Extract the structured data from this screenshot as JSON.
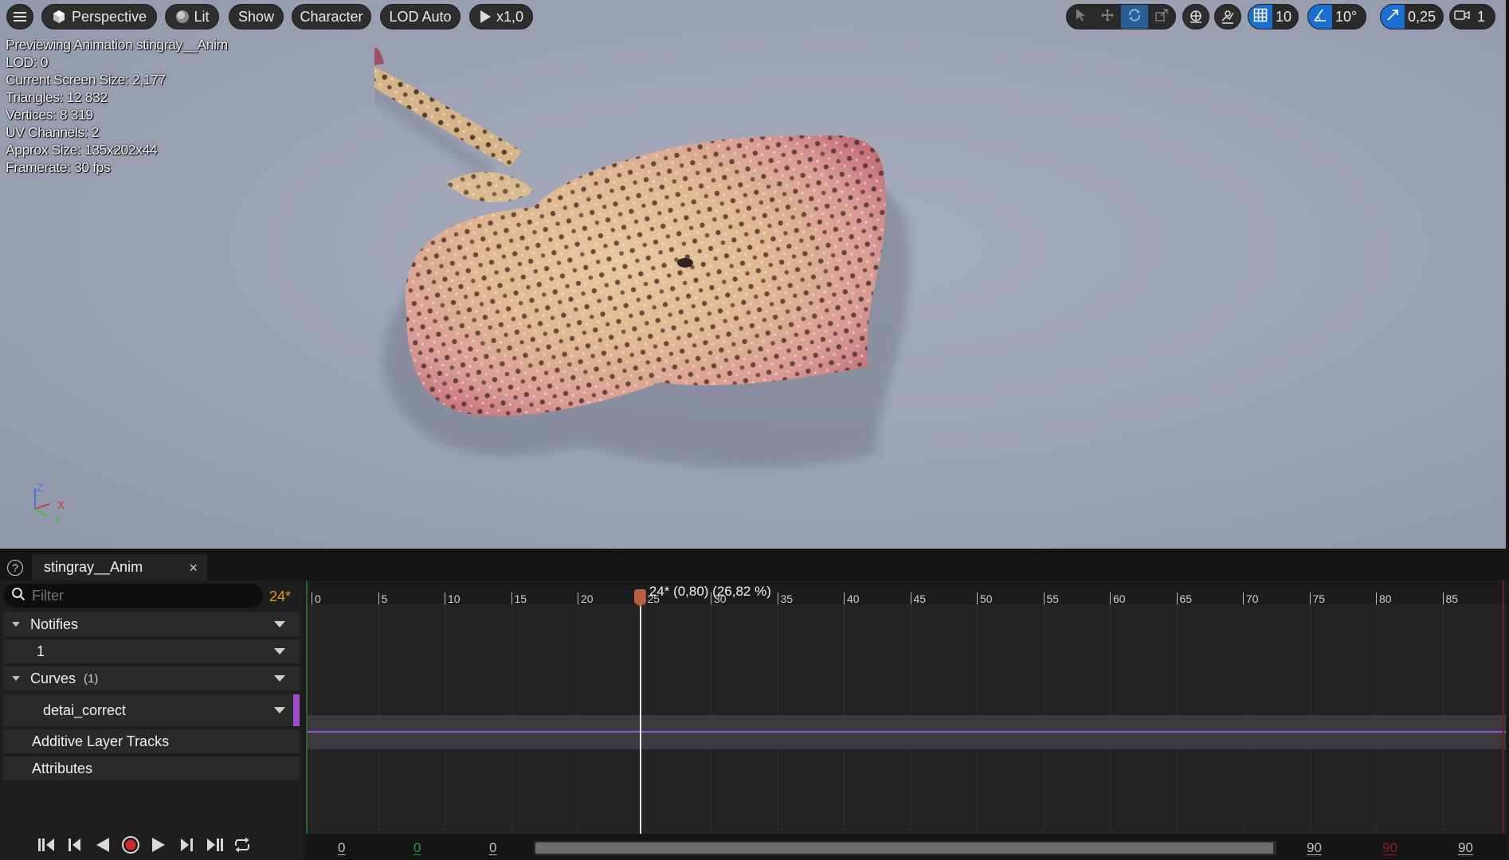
{
  "toolbar": {
    "menu_icon": "hamburger-icon",
    "perspective_label": "Perspective",
    "lit_label": "Lit",
    "show_label": "Show",
    "character_label": "Character",
    "lod_label": "LOD Auto",
    "speed_label": "x1,0",
    "grid_value": "10",
    "angle_value": "10°",
    "scale_value": "0,25",
    "camera_value": "1"
  },
  "stats": {
    "previewing": "Previewing Animation stingray__Anim",
    "lod": "LOD: 0",
    "screen_size": "Current Screen Size: 2,177",
    "triangles": "Triangles: 12 832",
    "vertices": "Vertices: 8 319",
    "uv_channels": "UV Channels: 2",
    "approx_size": "Approx Size: 135x202x44",
    "framerate": "Framerate: 30 fps"
  },
  "axis": {
    "z": "Z",
    "x": "X",
    "y": "Y"
  },
  "tab": {
    "title": "stingray__Anim",
    "close": "×"
  },
  "filter": {
    "placeholder": "Filter",
    "frame_badge": "24*"
  },
  "tracks": {
    "notifies": "Notifies",
    "notify_track": "1",
    "curves": "Curves",
    "curves_count": "(1)",
    "curve_name": "detai_correct",
    "additive": "Additive Layer Tracks",
    "attributes": "Attributes"
  },
  "timeline": {
    "playhead_label": "24* (0,80) (26,82 %)",
    "playhead_frame": 24,
    "total_frames": 90,
    "ticks": [
      "0",
      "5",
      "10",
      "15",
      "20",
      "25",
      "30",
      "35",
      "40",
      "45",
      "50",
      "55",
      "60",
      "65",
      "70",
      "75",
      "80",
      "85"
    ]
  },
  "range": {
    "view_start": "0",
    "working_start": "0",
    "play_start": "0",
    "view_end": "90",
    "working_end": "90",
    "play_end": "90"
  },
  "colors": {
    "accent_blue": "#1a6fd1",
    "frame_badge": "#e3961f",
    "curve": "#9e4fd1",
    "playhead": "#b75f3f"
  }
}
